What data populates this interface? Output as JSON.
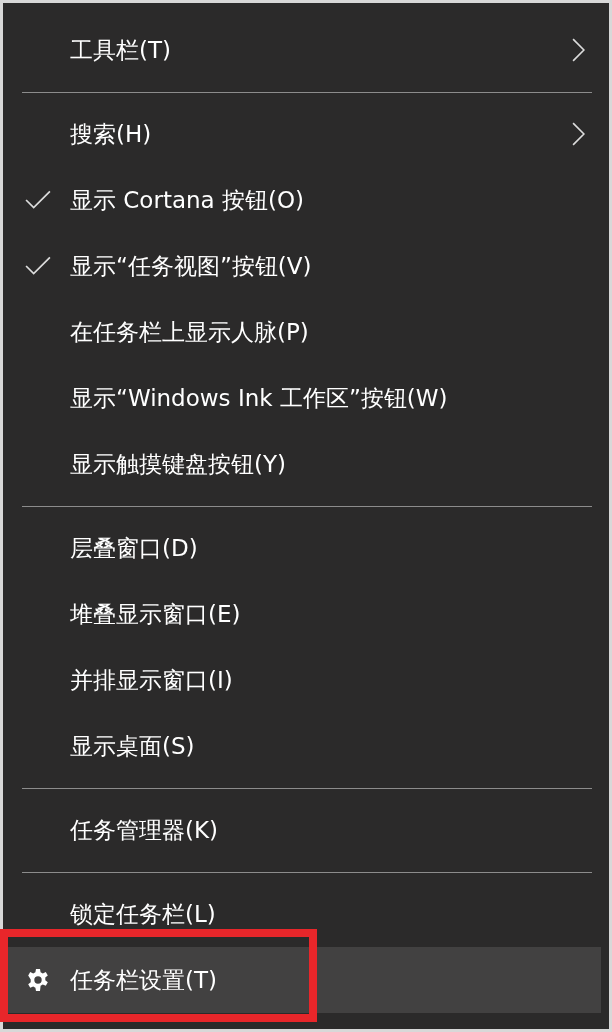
{
  "context_menu": {
    "items": [
      {
        "kind": "item",
        "label": "工具栏(T)",
        "checked": false,
        "submenu": true,
        "hovered": false,
        "icon": false,
        "framed": false
      },
      {
        "kind": "separator"
      },
      {
        "kind": "item",
        "label": "搜索(H)",
        "checked": false,
        "submenu": true,
        "hovered": false,
        "icon": false,
        "framed": false
      },
      {
        "kind": "item",
        "label": "显示 Cortana 按钮(O)",
        "checked": true,
        "submenu": false,
        "hovered": false,
        "icon": false,
        "framed": false
      },
      {
        "kind": "item",
        "label": "显示“任务视图”按钮(V)",
        "checked": true,
        "submenu": false,
        "hovered": false,
        "icon": false,
        "framed": false
      },
      {
        "kind": "item",
        "label": "在任务栏上显示人脉(P)",
        "checked": false,
        "submenu": false,
        "hovered": false,
        "icon": false,
        "framed": false
      },
      {
        "kind": "item",
        "label": "显示“Windows Ink 工作区”按钮(W)",
        "checked": false,
        "submenu": false,
        "hovered": false,
        "icon": false,
        "framed": false
      },
      {
        "kind": "item",
        "label": "显示触摸键盘按钮(Y)",
        "checked": false,
        "submenu": false,
        "hovered": false,
        "icon": false,
        "framed": false
      },
      {
        "kind": "separator"
      },
      {
        "kind": "item",
        "label": "层叠窗口(D)",
        "checked": false,
        "submenu": false,
        "hovered": false,
        "icon": false,
        "framed": false
      },
      {
        "kind": "item",
        "label": "堆叠显示窗口(E)",
        "checked": false,
        "submenu": false,
        "hovered": false,
        "icon": false,
        "framed": false
      },
      {
        "kind": "item",
        "label": "并排显示窗口(I)",
        "checked": false,
        "submenu": false,
        "hovered": false,
        "icon": false,
        "framed": false
      },
      {
        "kind": "item",
        "label": "显示桌面(S)",
        "checked": false,
        "submenu": false,
        "hovered": false,
        "icon": false,
        "framed": false
      },
      {
        "kind": "separator"
      },
      {
        "kind": "item",
        "label": "任务管理器(K)",
        "checked": false,
        "submenu": false,
        "hovered": false,
        "icon": false,
        "framed": false
      },
      {
        "kind": "separator"
      },
      {
        "kind": "item",
        "label": "锁定任务栏(L)",
        "checked": false,
        "submenu": false,
        "hovered": false,
        "icon": false,
        "framed": false
      },
      {
        "kind": "item",
        "label": "任务栏设置(T)",
        "checked": false,
        "submenu": false,
        "hovered": true,
        "icon": true,
        "framed": true
      }
    ]
  }
}
